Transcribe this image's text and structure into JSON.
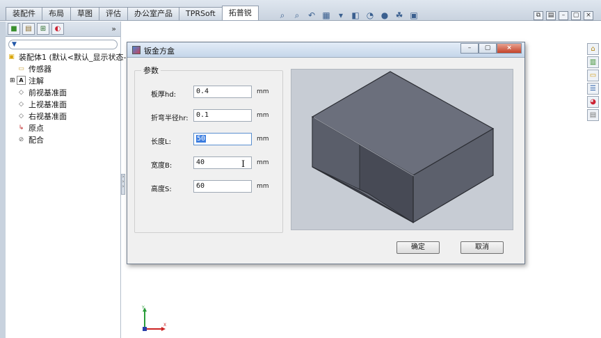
{
  "cad_tabs": [
    "装配件",
    "布局",
    "草图",
    "评估",
    "办公室产品",
    "TPRSoft",
    "拓普锐"
  ],
  "active_tab_index": 6,
  "feature_tree": {
    "filter_symbol": "▼",
    "root": "装配体1 (默认<默认_显示状态-",
    "items": [
      "传感器",
      "注解",
      "前视基准面",
      "上视基准面",
      "右视基准面",
      "原点",
      "配合"
    ]
  },
  "triad": {
    "y": "Y",
    "x": "X"
  },
  "dialog": {
    "title": "钣金方盒",
    "group_label": "参数",
    "fields": [
      {
        "label": "板厚hd:",
        "value": "0.4",
        "unit": "mm"
      },
      {
        "label": "折弯半径hr:",
        "value": "0.1",
        "unit": "mm"
      },
      {
        "label": "长度L:",
        "value": "50",
        "unit": "mm"
      },
      {
        "label": "宽度B:",
        "value": "40",
        "unit": "mm"
      },
      {
        "label": "高度S:",
        "value": "60",
        "unit": "mm"
      }
    ],
    "ok_label": "确定",
    "cancel_label": "取消"
  }
}
